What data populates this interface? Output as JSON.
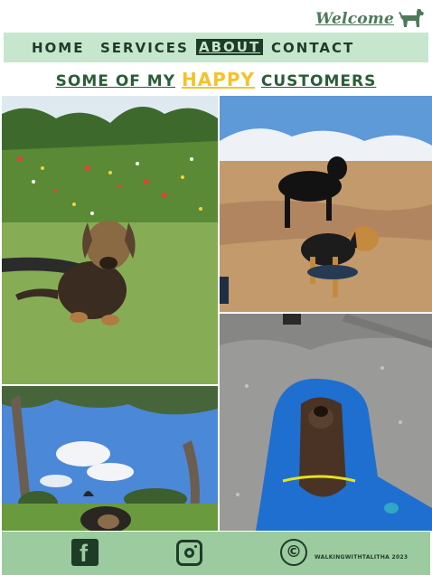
{
  "header": {
    "welcome_text": "Welcome",
    "logo_icon": "dog-icon"
  },
  "nav": {
    "items": [
      {
        "label": "HOME"
      },
      {
        "label": "SERVICES"
      },
      {
        "label": "ABOUT",
        "active": true
      },
      {
        "label": "CONTACT"
      }
    ]
  },
  "main": {
    "heading_prefix": "SOME OF MY",
    "heading_highlight": "HAPPY",
    "heading_suffix": "CUSTOMERS"
  },
  "gallery": {
    "photos": [
      {
        "subject": "terrier puppy sitting on grass in a flower meadow"
      },
      {
        "subject": "two dogs standing on a wet beach"
      },
      {
        "subject": "dog in a park under a blue sky with trees"
      },
      {
        "subject": "spaniel wrapped in a blue towel on pavement"
      }
    ]
  },
  "footer": {
    "facebook_icon": "facebook-icon",
    "instagram_icon": "instagram-icon",
    "copyright_symbol": "©",
    "copyright_text": "WALKINGWITHTALITHA 2023"
  },
  "colors": {
    "nav_bg": "#c6e6cd",
    "footer_bg": "#9bcb9f",
    "dark_green": "#1e3c26",
    "heading_green": "#2c5d3a",
    "highlight_yellow": "#f4c32a",
    "brand_green": "#4f7a5a"
  }
}
